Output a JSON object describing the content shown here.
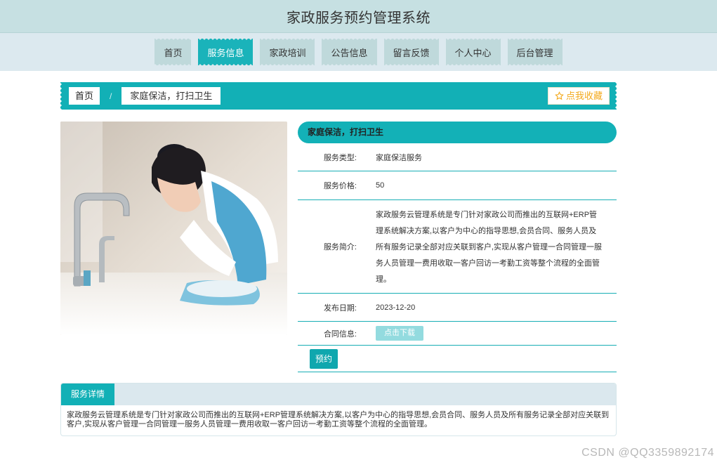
{
  "header": {
    "title": "家政服务预约管理系统"
  },
  "nav": {
    "items": [
      {
        "label": "首页"
      },
      {
        "label": "服务信息"
      },
      {
        "label": "家政培训"
      },
      {
        "label": "公告信息"
      },
      {
        "label": "留言反馈"
      },
      {
        "label": "个人中心"
      },
      {
        "label": "后台管理"
      }
    ],
    "active_index": 1
  },
  "breadcrumb": {
    "home": "首页",
    "separator": "/",
    "current": "家庭保洁，打扫卫生",
    "favorite_label": "点我收藏"
  },
  "detail": {
    "title": "家庭保洁，打扫卫生",
    "type_label": "服务类型:",
    "type_value": "家庭保洁服务",
    "price_label": "服务价格:",
    "price_value": "50",
    "intro_label": "服务简介:",
    "intro_value": "家政服务云管理系统是专门针对家政公司而推出的互联网+ERP管理系统解决方案,以客户为中心的指导思想,会员合同、服务人员及所有服务记录全部对应关联到客户,实现从客户管理一合同管理一服务人员管理一费用收取一客户回访一考勤工资等整个流程的全面管理。",
    "date_label": "发布日期:",
    "date_value": "2023-12-20",
    "contract_label": "合同信息:",
    "download_label": "点击下载",
    "book_label": "预约"
  },
  "service_detail": {
    "tab_label": "服务详情",
    "text": "家政服务云管理系统是专门针对家政公司而推出的互联网+ERP管理系统解决方案,以客户为中心的指导思想,会员合同、服务人员及所有服务记录全部对应关联到客户,实现从客户管理一合同管理一服务人员管理一费用收取一客户回访一考勤工资等整个流程的全面管理。"
  },
  "watermark": "CSDN @QQ3359892174",
  "colors": {
    "teal": "#12b0b6",
    "nav_bg": "#dce9ef",
    "header_bg": "#c6e0e2",
    "favorite": "#f3a91c"
  }
}
